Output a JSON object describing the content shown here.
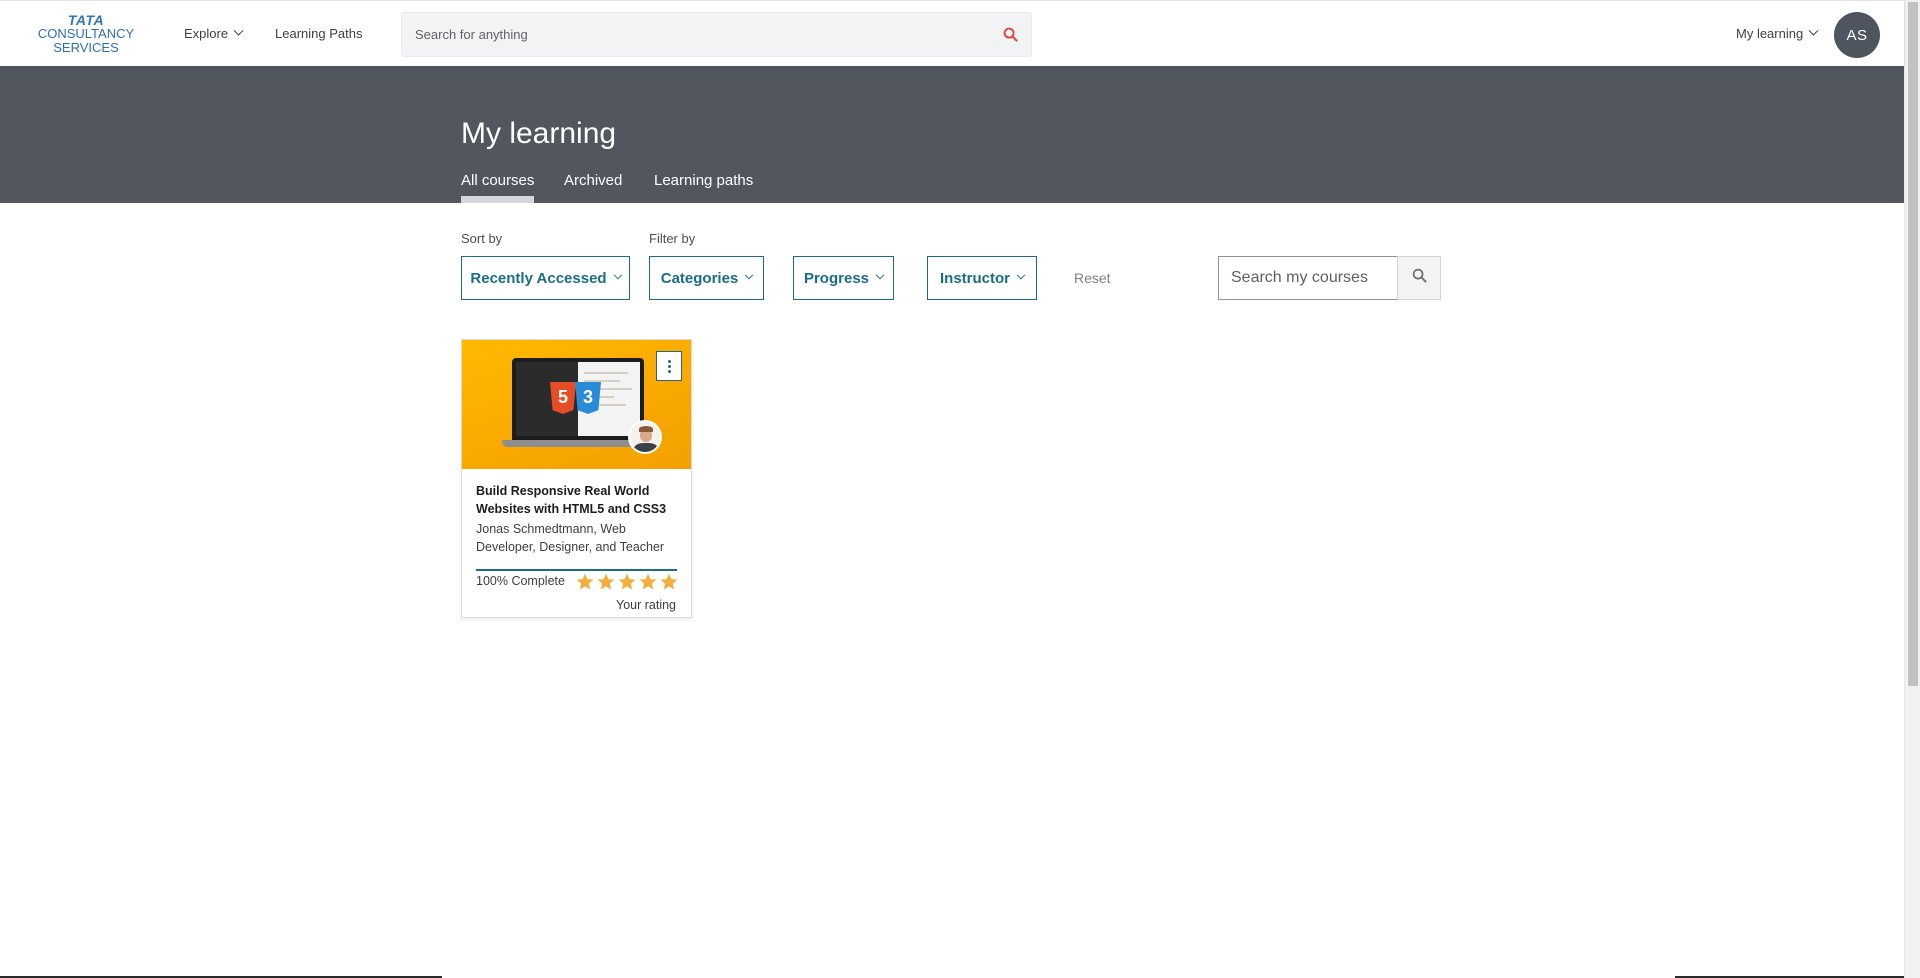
{
  "header": {
    "logo": {
      "line1": "TATA",
      "line2": "CONSULTANCY",
      "line3": "SERVICES"
    },
    "explore_label": "Explore",
    "learning_paths_label": "Learning Paths",
    "search_placeholder": "Search for anything",
    "my_learning_label": "My learning",
    "avatar_initials": "AS"
  },
  "banner": {
    "title": "My learning",
    "tabs": [
      {
        "label": "All courses",
        "active": true
      },
      {
        "label": "Archived",
        "active": false
      },
      {
        "label": "Learning paths",
        "active": false
      }
    ]
  },
  "filters": {
    "sort_label": "Sort by",
    "filter_label": "Filter by",
    "sort_value": "Recently Accessed",
    "categories_label": "Categories",
    "progress_label": "Progress",
    "instructor_label": "Instructor",
    "reset_label": "Reset",
    "search_placeholder": "Search my courses"
  },
  "courses": [
    {
      "title": "Build Responsive Real World Websites with HTML5 and CSS3",
      "instructor": "Jonas Schmedtmann, Web Developer, Designer, and Teacher",
      "progress_percent": 100,
      "progress_text": "100% Complete",
      "rating": 5,
      "rating_label": "Your rating",
      "thumbnail_badges": {
        "html": "5",
        "css": "3"
      }
    }
  ],
  "colors": {
    "brand_blue": "#2f76c2",
    "banner_bg": "#51565f",
    "accent_teal": "#1b6d87",
    "star_gold": "#f3ae3e",
    "search_icon_red": "#e0453c"
  }
}
